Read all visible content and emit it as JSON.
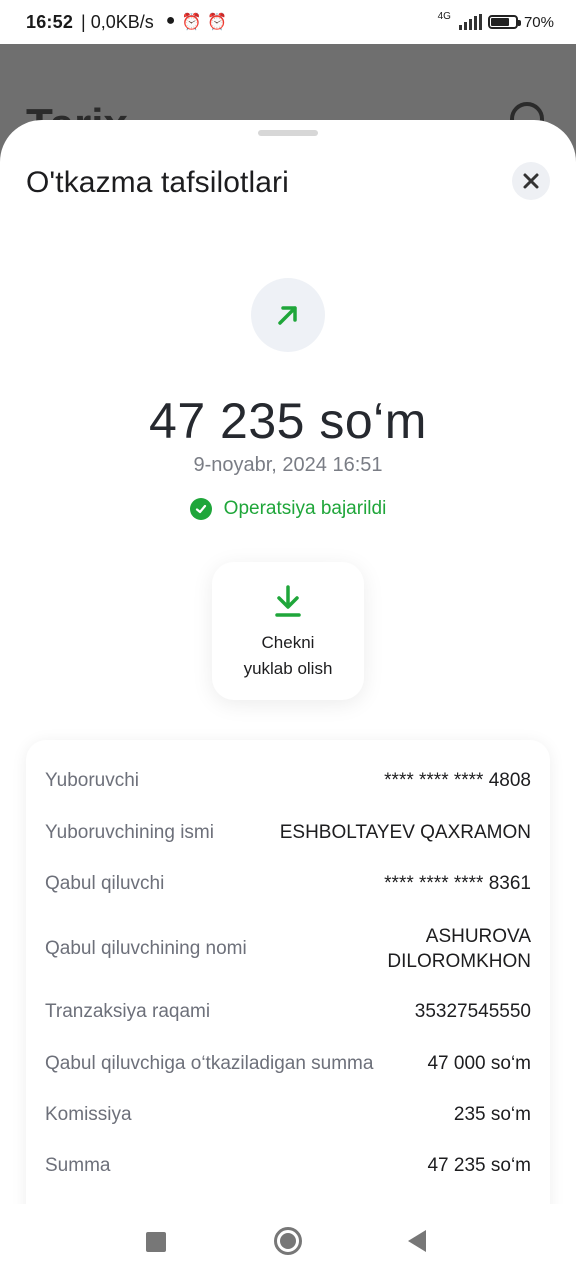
{
  "status_bar": {
    "time": "16:52",
    "speed": "| 0,0KB/s",
    "network": "4G",
    "battery": "70%",
    "battery_level": 0.7
  },
  "background_page": {
    "title": "Tarix"
  },
  "sheet": {
    "title": "O'tkazma tafsilotlari",
    "close_icon": "close-icon",
    "amount": "47 235 so‘m",
    "datetime": "9-noyabr, 2024 16:51",
    "status_text": "Operatsiya bajarildi",
    "accent": "#1fa63a",
    "download": {
      "line1": "Chekni",
      "line2": "yuklab olish"
    }
  },
  "details": [
    {
      "label": "Yuboruvchi",
      "value": "**** **** **** 4808"
    },
    {
      "label": "Yuboruvchining ismi",
      "value": "ESHBOLTAYEV QAXRAMON"
    },
    {
      "label": "Qabul qiluvchi",
      "value": "**** **** **** 8361"
    },
    {
      "label": "Qabul qiluvchining nomi",
      "value": "ASHUROVA",
      "value2": "DILOROMKHON"
    },
    {
      "label": "Tranzaksiya raqami",
      "value": "35327545550"
    },
    {
      "label": "Qabul qiluvchiga o‘tkaziladigan summa",
      "value": "47 000 so‘m"
    },
    {
      "label": "Komissiya",
      "value": "235 so‘m"
    },
    {
      "label": "Summa",
      "value": "47 235 so‘m"
    }
  ]
}
